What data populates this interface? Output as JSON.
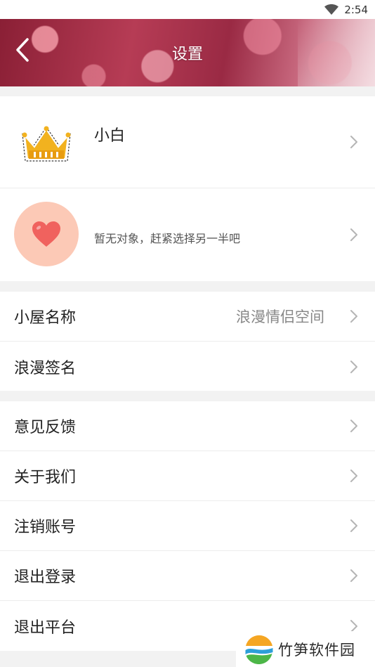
{
  "status_bar": {
    "time": "2:54",
    "icons": [
      "wifi-icon"
    ]
  },
  "header": {
    "title": "设置",
    "back_icon": "back-chevron-icon"
  },
  "profile": {
    "username": "小白",
    "avatar_icon": "crown-icon",
    "partner_text": "暂无对象，赶紧选择另一半吧",
    "partner_icon": "heart-icon"
  },
  "house": {
    "rows": [
      {
        "label": "小屋名称",
        "value": "浪漫情侣空间"
      },
      {
        "label": "浪漫签名",
        "value": ""
      }
    ]
  },
  "misc": {
    "rows": [
      {
        "label": "意见反馈"
      },
      {
        "label": "关于我们"
      },
      {
        "label": "注销账号"
      },
      {
        "label": "退出登录"
      },
      {
        "label": "退出平台"
      }
    ]
  },
  "watermark": {
    "text": "竹笋软件园"
  },
  "colors": {
    "page_bg": "#f2f2f2",
    "card_bg": "#ffffff",
    "heart": "#f0625e",
    "heart_circle": "#fcc9b6",
    "crown": "#f2b21f",
    "chevron": "#b5b5b5"
  }
}
